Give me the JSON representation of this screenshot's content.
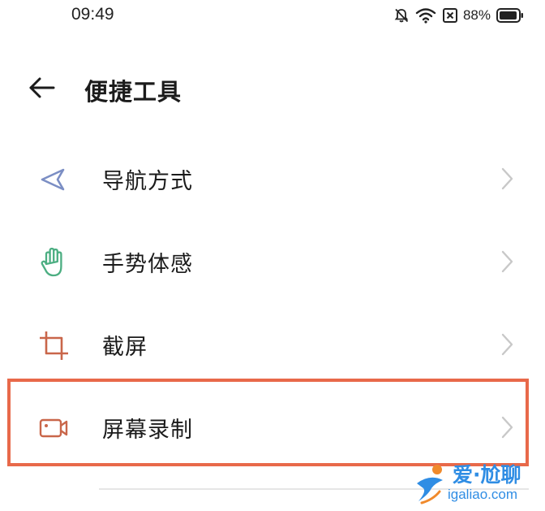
{
  "status_bar": {
    "time": "09:49",
    "battery_percent": "88%",
    "icons": [
      "bell-muted-icon",
      "wifi-icon",
      "sim-blocked-icon",
      "battery-icon"
    ]
  },
  "header": {
    "title": "便捷工具",
    "back_icon": "back-arrow-icon"
  },
  "menu": {
    "items": [
      {
        "label": "导航方式",
        "icon": "navigation-arrow-icon",
        "icon_color": "#7b8ec4"
      },
      {
        "label": "手势体感",
        "icon": "hand-gesture-icon",
        "icon_color": "#4cae82"
      },
      {
        "label": "截屏",
        "icon": "crop-icon",
        "icon_color": "#c9664a"
      },
      {
        "label": "屏幕录制",
        "icon": "video-camera-icon",
        "icon_color": "#c9664a",
        "highlighted": true
      }
    ]
  },
  "highlight_color": "#e8694a",
  "watermark": {
    "brand": "爱·尬聊",
    "url": "igaliao.com",
    "color": "#2f8de4"
  }
}
